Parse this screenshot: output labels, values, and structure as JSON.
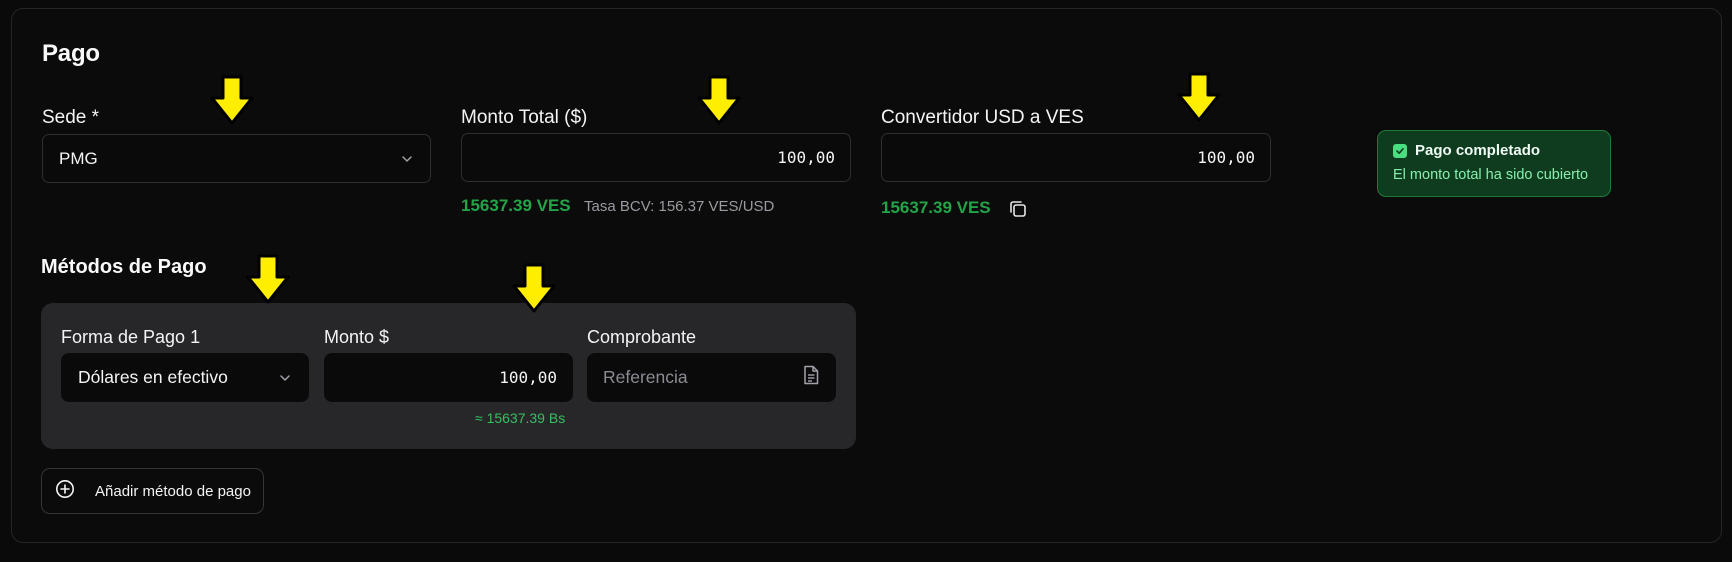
{
  "page": {
    "title": "Pago"
  },
  "sede": {
    "label": "Sede *",
    "value": "PMG"
  },
  "monto_total": {
    "label": "Monto Total ($)",
    "value": "100,00",
    "ves_amount": "15637.39 VES",
    "rate_text": "Tasa BCV: 156.37 VES/USD"
  },
  "convertidor": {
    "label": "Convertidor USD a VES",
    "value": "100,00",
    "ves_amount": "15637.39 VES"
  },
  "status": {
    "title": "Pago completado",
    "description": "El monto total ha sido cubierto"
  },
  "metodos": {
    "title": "Métodos de Pago",
    "items": [
      {
        "forma_label": "Forma de Pago 1",
        "forma_value": "Dólares en efectivo",
        "monto_label": "Monto $",
        "monto_value": "100,00",
        "approx": "≈ 15637.39 Bs",
        "comprobante_label": "Comprobante",
        "comprobante_placeholder": "Referencia"
      }
    ],
    "add_button": "Añadir método de pago"
  },
  "colors": {
    "background": "#0a0a0b",
    "accent_green": "#22a447",
    "status_bg": "#0f3b1f",
    "annotation_arrow": "#ffee00"
  },
  "icons": {
    "dropdown": "chevron-down-icon",
    "copy": "copy-icon",
    "check": "check-square-icon",
    "file": "file-text-icon",
    "add": "plus-circle-icon",
    "annotation": "arrow-down-annotation"
  }
}
